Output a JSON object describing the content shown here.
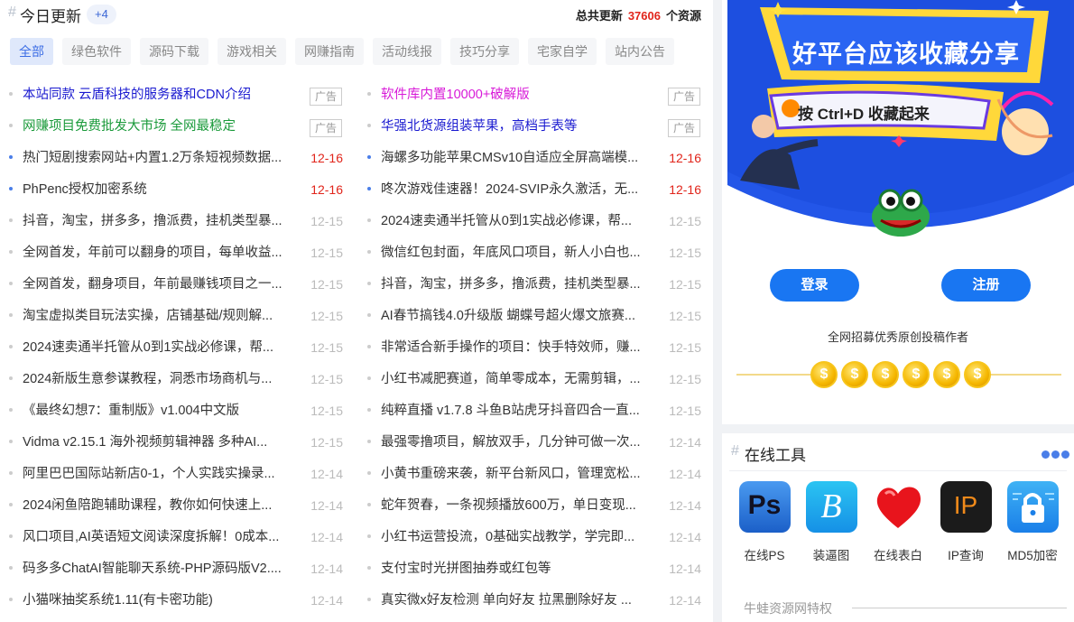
{
  "header": {
    "hash": "#",
    "title": "今日更新",
    "badge": "+4",
    "total_prefix": "总共更新",
    "total_count": "37606",
    "total_suffix": "个资源"
  },
  "categories": [
    "全部",
    "绿色软件",
    "源码下载",
    "游戏相关",
    "网赚指南",
    "活动线报",
    "技巧分享",
    "宅家自学",
    "站内公告"
  ],
  "active_category": "全部",
  "ad_label": "广告",
  "rows": [
    [
      {
        "text": "本站同款 云盾科技的服务器和CDN介绍",
        "color": "#1a1ad0",
        "ad": true
      },
      {
        "text": "软件库内置10000+破解版",
        "color": "#d81ad8",
        "ad": true
      }
    ],
    [
      {
        "text": "网赚项目免费批发大市场 全网最稳定",
        "color": "#1a9a3a",
        "ad": true
      },
      {
        "text": "华强北货源组装苹果，高档手表等",
        "color": "#1a1ad0",
        "ad": true
      }
    ],
    [
      {
        "text": "热门短剧搜索网站+内置1.2万条短视频数据...",
        "date": "12-16",
        "hot": true
      },
      {
        "text": "海螺多功能苹果CMSv10自适应全屏高端模...",
        "date": "12-16",
        "hot": true
      }
    ],
    [
      {
        "text": "PhPenc授权加密系统",
        "date": "12-16",
        "hot": true
      },
      {
        "text": "咚次游戏佳速器！2024-SVIP永久激活，无...",
        "date": "12-16",
        "hot": true
      }
    ],
    [
      {
        "text": "抖音，淘宝，拼多多，撸派费，挂机类型暴...",
        "date": "12-15"
      },
      {
        "text": "2024速卖通半托管从0到1实战必修课，帮...",
        "date": "12-15"
      }
    ],
    [
      {
        "text": "全网首发，年前可以翻身的项目，每单收益...",
        "date": "12-15"
      },
      {
        "text": "微信红包封面，年底风口项目，新人小白也...",
        "date": "12-15"
      }
    ],
    [
      {
        "text": "全网首发，翻身项目，年前最赚钱项目之一...",
        "date": "12-15"
      },
      {
        "text": "抖音，淘宝，拼多多，撸派费，挂机类型暴...",
        "date": "12-15"
      }
    ],
    [
      {
        "text": "淘宝虚拟类目玩法实操，店铺基础/规则解...",
        "date": "12-15"
      },
      {
        "text": "AI春节搞钱4.0升级版 蝴蝶号超火爆文旅赛...",
        "date": "12-15"
      }
    ],
    [
      {
        "text": "2024速卖通半托管从0到1实战必修课，帮...",
        "date": "12-15"
      },
      {
        "text": "非常适合新手操作的项目：快手特效师，赚...",
        "date": "12-15"
      }
    ],
    [
      {
        "text": "2024新版生意参谋教程，洞悉市场商机与...",
        "date": "12-15"
      },
      {
        "text": "小红书减肥赛道，简单零成本，无需剪辑，...",
        "date": "12-15"
      }
    ],
    [
      {
        "text": "《最终幻想7：重制版》v1.004中文版",
        "date": "12-15"
      },
      {
        "text": "纯粹直播 v1.7.8 斗鱼B站虎牙抖音四合一直...",
        "date": "12-15"
      }
    ],
    [
      {
        "text": "Vidma v2.15.1 海外视频剪辑神器 多种AI...",
        "date": "12-15"
      },
      {
        "text": "最强零撸项目，解放双手，几分钟可做一次...",
        "date": "12-14"
      }
    ],
    [
      {
        "text": "阿里巴巴国际站新店0-1，个人实践实操录...",
        "date": "12-14"
      },
      {
        "text": "小黄书重磅来袭，新平台新风口，管理宽松...",
        "date": "12-14"
      }
    ],
    [
      {
        "text": "2024闲鱼陪跑辅助课程，教你如何快速上...",
        "date": "12-14"
      },
      {
        "text": "蛇年贺春，一条视频播放600万，单日变现...",
        "date": "12-14"
      }
    ],
    [
      {
        "text": "风口项目,AI英语短文阅读深度拆解！0成本...",
        "date": "12-14"
      },
      {
        "text": "小红书运营投流，0基础实战教学，学完即...",
        "date": "12-14"
      }
    ],
    [
      {
        "text": "码多多ChatAI智能聊天系统-PHP源码版V2....",
        "date": "12-14"
      },
      {
        "text": "支付宝时光拼图抽券或红包等",
        "date": "12-14"
      }
    ],
    [
      {
        "text": "小猫咪抽奖系统1.11(有卡密功能)",
        "date": "12-14"
      },
      {
        "text": "真实微x好友检测 单向好友 拉黑删除好友 ...",
        "date": "12-14"
      }
    ]
  ],
  "banner": {
    "headline": "好平台应该收藏分享",
    "shortcut": "按 Ctrl+D 收藏起来"
  },
  "auth": {
    "login": "登录",
    "register": "注册"
  },
  "recruit": "全网招募优秀原创投稿作者",
  "coin_symbol": "$",
  "tools": {
    "hash": "#",
    "title": "在线工具",
    "items": [
      {
        "label": "在线PS",
        "icon": "photoshop-icon",
        "glyph": "Ps"
      },
      {
        "label": "装逼图",
        "icon": "b-logo-icon",
        "glyph": "B"
      },
      {
        "label": "在线表白",
        "icon": "heart-icon",
        "glyph": ""
      },
      {
        "label": "IP查询",
        "icon": "ip-icon",
        "glyph": "IP"
      },
      {
        "label": "MD5加密",
        "icon": "lock-icon",
        "glyph": ""
      }
    ]
  },
  "privilege": "牛蛙资源网特权",
  "colors": {
    "accent": "#1976f2",
    "hot_date": "#e1251b",
    "badge_blue": "#3a66d6"
  }
}
